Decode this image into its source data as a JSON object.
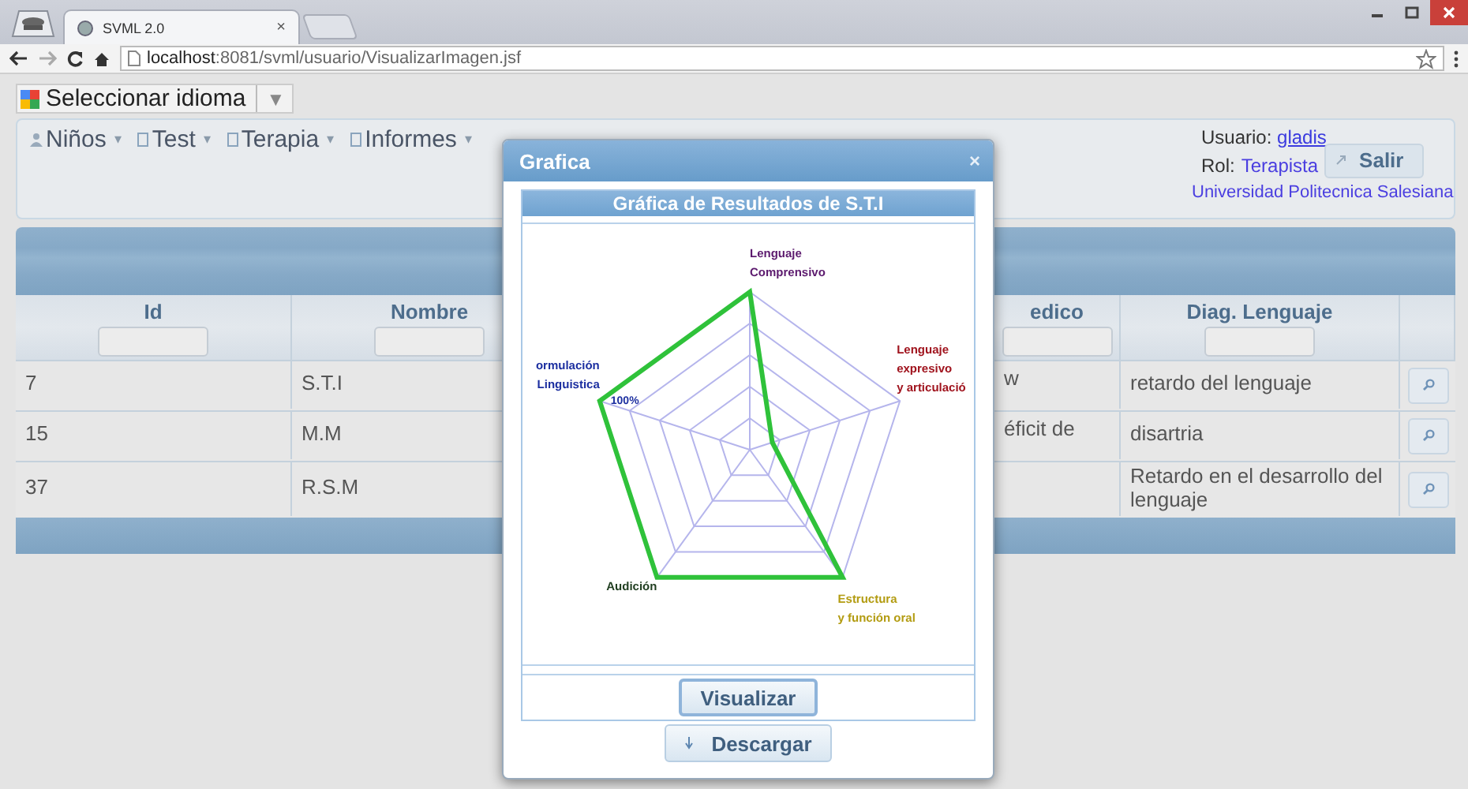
{
  "browser": {
    "tab": {
      "title": "SVML 2.0",
      "close": "×"
    },
    "address": "**localhost**:8081/svml/usuario/VisualizarImagen.jsf"
  },
  "language_selector": {
    "label": "Seleccionar idioma",
    "caret": "▼"
  },
  "menu": [
    {
      "label": "Niños",
      "caret": "▾",
      "kind": "person"
    },
    {
      "label": "Test",
      "caret": "▾",
      "kind": "page"
    },
    {
      "label": "Terapia",
      "caret": "▾",
      "kind": "page"
    },
    {
      "label": "Informes",
      "caret": "▾",
      "kind": "page"
    }
  ],
  "user": {
    "usuario_label": "Usuario:",
    "usuario": "gladis",
    "rol_label": "Rol:",
    "rol": "Terapista",
    "logout": "Salir",
    "institution": "Universidad Politecnica Salesiana"
  },
  "table": {
    "columns": [
      {
        "label": "Id",
        "kind": "text"
      },
      {
        "label": "Nombre",
        "kind": "text"
      },
      {
        "label": "edico",
        "kind": "text"
      },
      {
        "label": "Diag. Lenguaje",
        "kind": "text"
      },
      {
        "kind": "action"
      }
    ],
    "rows": [
      {
        "id": "7",
        "nombre": "S.T.I",
        "column_3": "w",
        "diag_lenguaje": "retardo del lenguaje"
      },
      {
        "id": "15",
        "nombre": "M.M",
        "column_3": "éficit de",
        "diag_lenguaje": "disartria"
      },
      {
        "id": "37",
        "nombre": "R.S.M",
        "diag_lenguaje": "Retardo en el desarrollo del lenguaje"
      }
    ]
  },
  "dialog": {
    "title": "Grafica",
    "close": "×",
    "panel_title": "Gráfica de Resultados de S.T.I",
    "chart": {
      "ticks": [
        "100%"
      ],
      "axes": [
        {
          "label": [
            "Lenguaje",
            "Comprensivo"
          ],
          "color": "#5c1a6e"
        },
        {
          "label": [
            "Lenguaje",
            "expresivo",
            "y articulació"
          ],
          "color": "#a0141e"
        },
        {
          "label": [
            "Estructura",
            "y función oral"
          ],
          "color": "#b39c12"
        },
        {
          "label": [
            "Audición"
          ],
          "color": "#1f3d1f"
        },
        {
          "label": [
            "ormulación",
            "Linguistica"
          ],
          "color": "#1c2fa0"
        }
      ]
    },
    "buttons": [
      {
        "label": "Visualizar",
        "kind": "plain",
        "focused": true
      },
      {
        "label": "Descargar",
        "kind": "download",
        "focused": false
      }
    ]
  }
}
